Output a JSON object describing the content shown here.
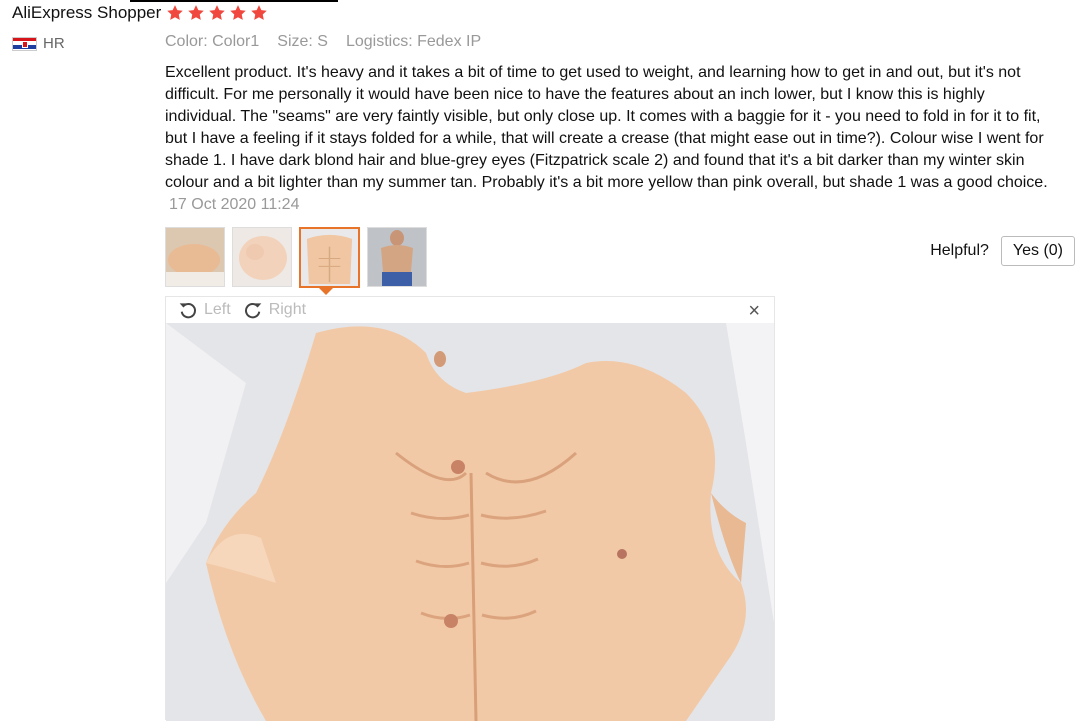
{
  "review": {
    "author": "AliExpress Shopper",
    "rating": 5,
    "country": "HR",
    "meta": {
      "color": "Color: Color1",
      "size": "Size: S",
      "logistics": "Logistics: Fedex IP"
    },
    "text": "Excellent product. It's heavy and it takes a bit of time to get used to weight, and learning how to get in and out, but it's not difficult. For me personally it would have been nice to have the features about an inch lower, but I know this is highly individual. The \"seams\" are very faintly visible, but only close up. It comes with a baggie for it - you need to fold in for it to fit, but I have a feeling if it stays folded for a while, that will create a crease (that might ease out in time?). Colour wise I went for shade 1. I have dark blond hair and blue-grey eyes (Fitzpatrick scale 2) and found that it's a bit darker than my winter skin colour and a bit lighter than my summer tan. Probably it's a bit more yellow than pink overall, but shade 1 was a good choice.",
    "date": "17 Oct 2020 11:24"
  },
  "helpful": {
    "label": "Helpful?",
    "button": "Yes (0)"
  },
  "viewer": {
    "rotate_left": "Left",
    "rotate_right": "Right",
    "close": "×"
  },
  "colors": {
    "star": "#f0483e",
    "accent": "#e8742a",
    "muted": "#999999"
  }
}
